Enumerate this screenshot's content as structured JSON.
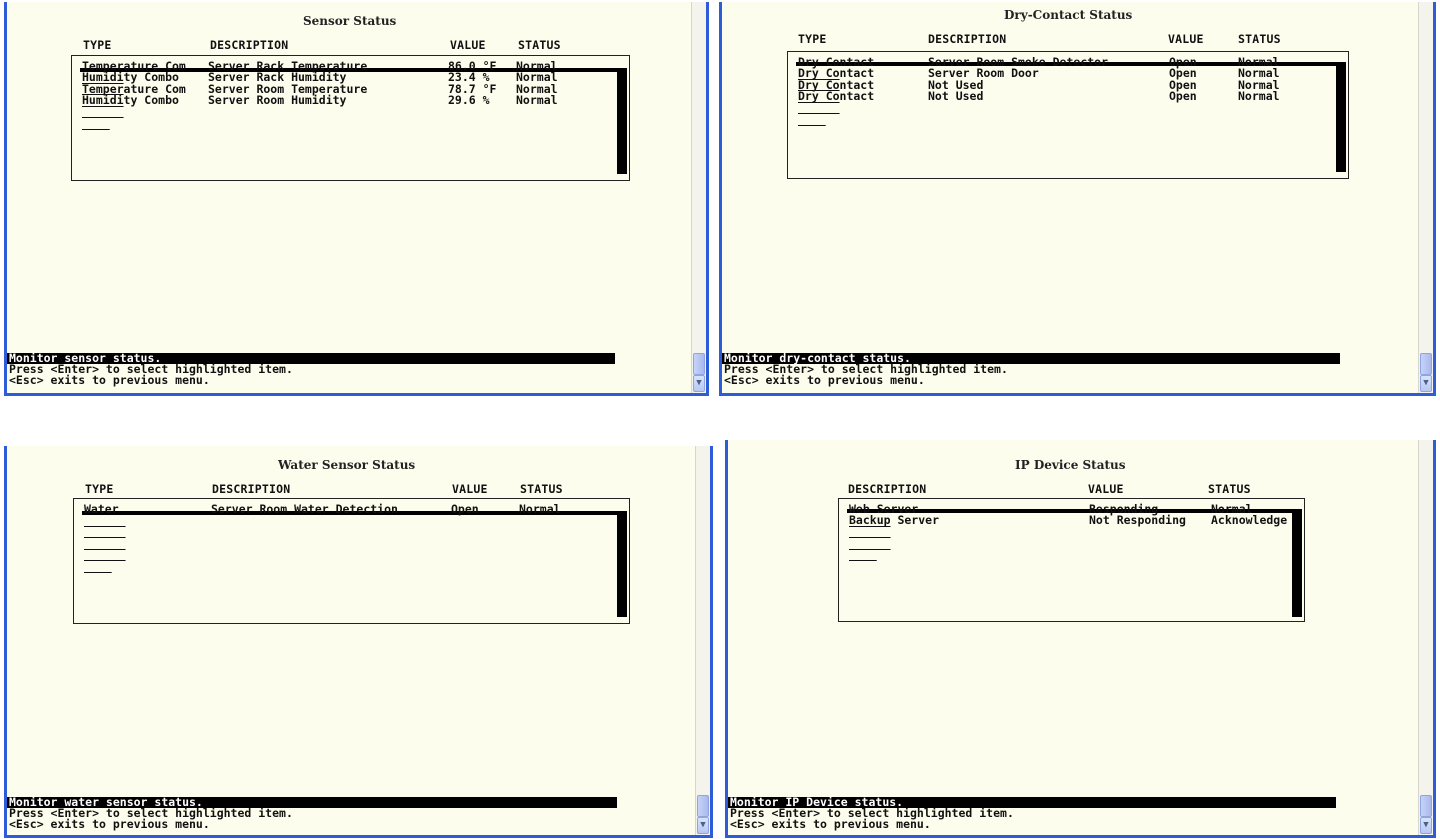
{
  "panels": [
    {
      "title": "Sensor Status",
      "headers": [
        "TYPE",
        "DESCRIPTION",
        "VALUE",
        "STATUS"
      ],
      "rows": [
        [
          "Temperature Com",
          "Server Rack Temperature",
          "86.0 °F",
          "Normal"
        ],
        [
          "Humidity Combo",
          "Server Rack Humidity",
          "23.4 %",
          "Normal"
        ],
        [
          "Temperature Com",
          "Server Room Temperature",
          "78.7 °F",
          "Normal"
        ],
        [
          "Humidity Combo",
          "Server Room Humidity",
          "29.6 %",
          "Normal"
        ]
      ],
      "status_line": "Monitor sensor status.",
      "help1": "Press <Enter> to select highlighted item.",
      "help2": "<Esc> exits to previous menu."
    },
    {
      "title": "Dry-Contact Status",
      "headers": [
        "TYPE",
        "DESCRIPTION",
        "VALUE",
        "STATUS"
      ],
      "rows": [
        [
          "Dry Contact",
          "Server Room Smoke Detector",
          "Open",
          "Normal"
        ],
        [
          "Dry Contact",
          "Server Room Door",
          "Open",
          "Normal"
        ],
        [
          "Dry Contact",
          "Not Used",
          "Open",
          "Normal"
        ],
        [
          "Dry Contact",
          "Not Used",
          "Open",
          "Normal"
        ]
      ],
      "status_line": "Monitor dry-contact status.",
      "help1": "Press <Enter> to select highlighted item.",
      "help2": "<Esc> exits to previous menu."
    },
    {
      "title": "Water Sensor Status",
      "headers": [
        "TYPE",
        "DESCRIPTION",
        "VALUE",
        "STATUS"
      ],
      "rows": [
        [
          "Water",
          "Server Room Water Detection",
          "Open",
          "Normal"
        ]
      ],
      "status_line": "Monitor water sensor status.",
      "help1": "Press <Enter> to select highlighted item.",
      "help2": "<Esc> exits to previous menu."
    },
    {
      "title": "IP Device Status",
      "headers": [
        "DESCRIPTION",
        "VALUE",
        "STATUS"
      ],
      "rows": [
        [
          "Web Server",
          "Responding",
          "Normal"
        ],
        [
          "Backup Server",
          "Not Responding",
          "Acknowledge"
        ]
      ],
      "status_line": "Monitor IP Device status.",
      "help1": "Press <Enter> to select highlighted item.",
      "help2": "<Esc> exits to previous menu."
    }
  ],
  "colors": {
    "terminal_bg": "#fdfdee",
    "window_border": "#2e5bd8",
    "text": "#111111",
    "highlight": "#000000"
  },
  "icons": {
    "scroll_down": "chevron-down-icon"
  }
}
